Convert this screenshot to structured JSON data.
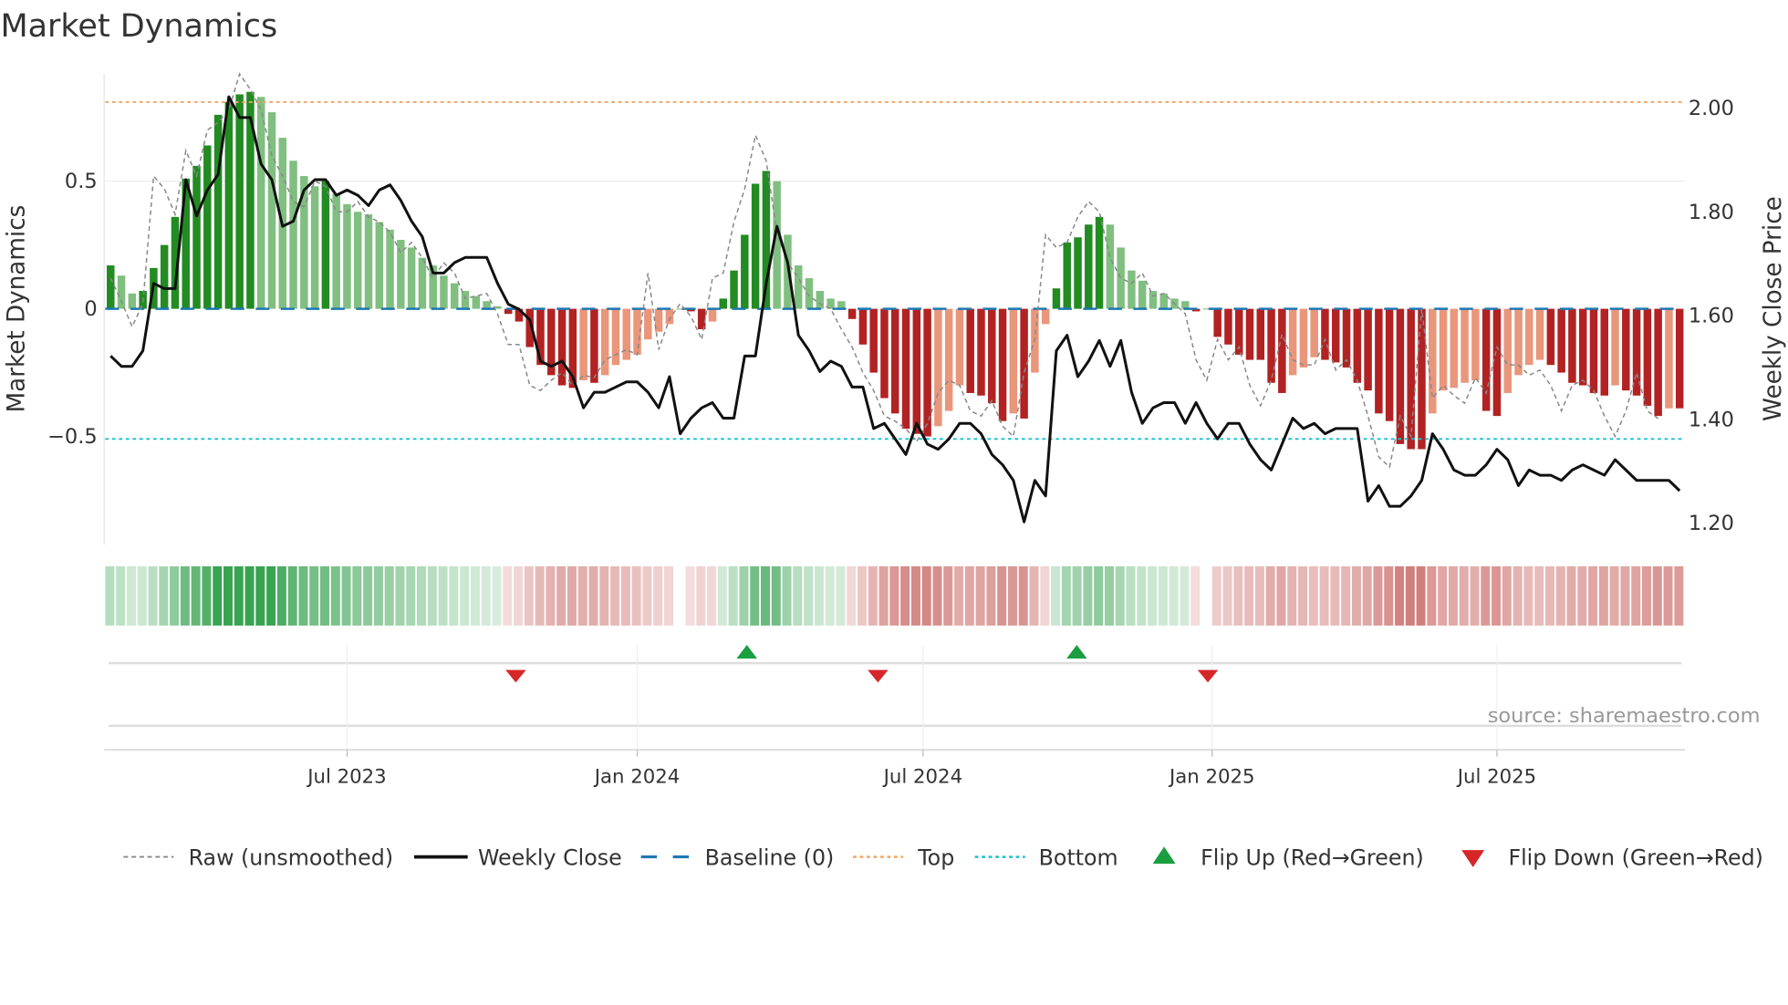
{
  "title": "Market Dynamics",
  "source": "source: sharemaestro.com",
  "colors": {
    "pos_strong": "#228b22",
    "pos_weak": "#80bf80",
    "neg_strong": "#b22222",
    "neg_weak": "#e9967a",
    "heat_pos": "#2e9e48",
    "heat_neg": "#c0504d",
    "baseline": "#1f77b4",
    "top": "#f4a460",
    "bottom": "#17becf",
    "close": "#111111",
    "raw": "#888888",
    "flip_up": "#1a9e3f",
    "flip_down": "#d62728"
  },
  "chart_data": {
    "type": "bar",
    "title": "Market Dynamics",
    "ylabel": "Market Dynamics",
    "y2label": "Weekly Close Price",
    "ylim": [
      -0.92,
      0.92
    ],
    "y2lim": [
      1.18,
      2.04
    ],
    "yticks": [
      {
        "v": 0.5,
        "label": "0.5"
      },
      {
        "v": 0,
        "label": "0"
      },
      {
        "v": -0.5,
        "label": "−0.5"
      }
    ],
    "y2ticks": [
      {
        "v": 2.0,
        "label": "2.00"
      },
      {
        "v": 1.8,
        "label": "1.80"
      },
      {
        "v": 1.6,
        "label": "1.60"
      },
      {
        "v": 1.4,
        "label": "1.40"
      },
      {
        "v": 1.2,
        "label": "1.20"
      }
    ],
    "xticks": [
      {
        "week": 22,
        "label": "Jul 2023"
      },
      {
        "week": 49,
        "label": "Jan 2024"
      },
      {
        "week": 75.6,
        "label": "Jul 2024"
      },
      {
        "week": 102.5,
        "label": "Jan 2025"
      },
      {
        "week": 129,
        "label": "Jul 2025"
      }
    ],
    "top_level": 0.81,
    "bottom_level": -0.51,
    "momentum": [
      0.17,
      0.13,
      0.06,
      0.07,
      0.16,
      0.25,
      0.36,
      0.51,
      0.56,
      0.64,
      0.76,
      0.81,
      0.84,
      0.85,
      0.83,
      0.77,
      0.67,
      0.58,
      0.52,
      0.48,
      0.5,
      0.45,
      0.41,
      0.38,
      0.37,
      0.34,
      0.31,
      0.27,
      0.24,
      0.2,
      0.17,
      0.13,
      0.1,
      0.07,
      0.05,
      0.03,
      0.01,
      -0.02,
      -0.05,
      -0.15,
      -0.22,
      -0.26,
      -0.3,
      -0.31,
      -0.28,
      -0.29,
      -0.26,
      -0.22,
      -0.2,
      -0.18,
      -0.12,
      -0.09,
      -0.06,
      0,
      -0.01,
      -0.08,
      -0.05,
      0.04,
      0.15,
      0.29,
      0.49,
      0.54,
      0.5,
      0.29,
      0.17,
      0.12,
      0.07,
      0.04,
      0.03,
      -0.04,
      -0.14,
      -0.25,
      -0.35,
      -0.41,
      -0.47,
      -0.49,
      -0.5,
      -0.46,
      -0.4,
      -0.3,
      -0.33,
      -0.34,
      -0.37,
      -0.44,
      -0.41,
      -0.43,
      -0.25,
      -0.06,
      0.08,
      0.26,
      0.28,
      0.33,
      0.36,
      0.33,
      0.24,
      0.15,
      0.11,
      0.07,
      0.06,
      0.04,
      0.03,
      -0.01,
      0,
      -0.11,
      -0.14,
      -0.18,
      -0.2,
      -0.2,
      -0.29,
      -0.33,
      -0.26,
      -0.23,
      -0.19,
      -0.2,
      -0.21,
      -0.23,
      -0.29,
      -0.32,
      -0.41,
      -0.44,
      -0.53,
      -0.55,
      -0.55,
      -0.41,
      -0.32,
      -0.31,
      -0.29,
      -0.28,
      -0.4,
      -0.42,
      -0.33,
      -0.26,
      -0.22,
      -0.2,
      -0.22,
      -0.25,
      -0.29,
      -0.3,
      -0.33,
      -0.34,
      -0.3,
      -0.32,
      -0.34,
      -0.38,
      -0.42,
      -0.39,
      -0.39
    ],
    "raw": [
      0.12,
      0.03,
      -0.07,
      0.02,
      0.52,
      0.47,
      0.37,
      0.62,
      0.52,
      0.7,
      0.73,
      0.78,
      0.92,
      0.86,
      0.78,
      0.6,
      0.52,
      0.42,
      0.4,
      0.5,
      0.48,
      0.38,
      0.38,
      0.42,
      0.36,
      0.34,
      0.3,
      0.22,
      0.26,
      0.2,
      0.12,
      0.18,
      0.14,
      0.04,
      0.05,
      0.06,
      -0.02,
      -0.14,
      -0.14,
      -0.3,
      -0.32,
      -0.28,
      -0.25,
      -0.3,
      -0.26,
      -0.27,
      -0.2,
      -0.18,
      -0.16,
      -0.18,
      0.14,
      -0.16,
      -0.04,
      0.02,
      -0.03,
      -0.12,
      0.12,
      0.14,
      0.34,
      0.47,
      0.68,
      0.58,
      0.3,
      0.18,
      0.12,
      0.05,
      0.02,
      0.0,
      -0.08,
      -0.15,
      -0.25,
      -0.32,
      -0.42,
      -0.44,
      -0.47,
      -0.52,
      -0.45,
      -0.33,
      -0.28,
      -0.3,
      -0.4,
      -0.42,
      -0.36,
      -0.46,
      -0.5,
      -0.25,
      -0.12,
      0.29,
      0.24,
      0.26,
      0.36,
      0.42,
      0.38,
      0.2,
      0.12,
      0.1,
      0.14,
      0.05,
      0.06,
      0.02,
      -0.02,
      -0.2,
      -0.28,
      -0.12,
      -0.2,
      -0.15,
      -0.3,
      -0.38,
      -0.28,
      -0.1,
      -0.2,
      -0.22,
      -0.22,
      -0.12,
      -0.24,
      -0.2,
      -0.28,
      -0.42,
      -0.58,
      -0.62,
      -0.42,
      -0.5,
      0.0,
      -0.35,
      -0.3,
      -0.34,
      -0.37,
      -0.27,
      -0.33,
      -0.15,
      -0.22,
      -0.22,
      -0.26,
      -0.24,
      -0.3,
      -0.4,
      -0.3,
      -0.28,
      -0.32,
      -0.42,
      -0.5,
      -0.4,
      -0.25,
      -0.4,
      -0.43
    ],
    "close": [
      1.52,
      1.5,
      1.5,
      1.53,
      1.66,
      1.65,
      1.65,
      1.86,
      1.79,
      1.84,
      1.87,
      2.02,
      1.98,
      1.98,
      1.89,
      1.86,
      1.77,
      1.78,
      1.84,
      1.86,
      1.86,
      1.83,
      1.84,
      1.83,
      1.81,
      1.84,
      1.85,
      1.82,
      1.78,
      1.75,
      1.68,
      1.68,
      1.7,
      1.71,
      1.71,
      1.71,
      1.66,
      1.62,
      1.61,
      1.59,
      1.51,
      1.5,
      1.51,
      1.48,
      1.42,
      1.45,
      1.45,
      1.46,
      1.47,
      1.47,
      1.45,
      1.42,
      1.48,
      1.37,
      1.4,
      1.42,
      1.43,
      1.4,
      1.4,
      1.52,
      1.52,
      1.66,
      1.77,
      1.7,
      1.56,
      1.53,
      1.49,
      1.51,
      1.5,
      1.46,
      1.46,
      1.38,
      1.39,
      1.36,
      1.33,
      1.39,
      1.35,
      1.34,
      1.36,
      1.39,
      1.39,
      1.37,
      1.33,
      1.31,
      1.28,
      1.2,
      1.28,
      1.25,
      1.53,
      1.56,
      1.48,
      1.51,
      1.55,
      1.5,
      1.55,
      1.45,
      1.39,
      1.42,
      1.43,
      1.43,
      1.39,
      1.43,
      1.39,
      1.36,
      1.39,
      1.39,
      1.35,
      1.32,
      1.3,
      1.35,
      1.4,
      1.38,
      1.39,
      1.37,
      1.38,
      1.38,
      1.38,
      1.24,
      1.27,
      1.23,
      1.23,
      1.25,
      1.28,
      1.37,
      1.34,
      1.3,
      1.29,
      1.29,
      1.31,
      1.34,
      1.32,
      1.27,
      1.3,
      1.29,
      1.29,
      1.28,
      1.3,
      1.31,
      1.3,
      1.29,
      1.32,
      1.3,
      1.28,
      1.28,
      1.28,
      1.28,
      1.26
    ],
    "flips": [
      {
        "week": 37.7,
        "dir": "down"
      },
      {
        "week": 59.2,
        "dir": "up"
      },
      {
        "week": 71.4,
        "dir": "down"
      },
      {
        "week": 89.9,
        "dir": "up"
      },
      {
        "week": 102.1,
        "dir": "down"
      }
    ],
    "legend": {
      "placement": "bottom",
      "items": [
        {
          "key": "raw",
          "label": "Raw (unsmoothed)"
        },
        {
          "key": "close",
          "label": "Weekly Close"
        },
        {
          "key": "baseline",
          "label": "Baseline (0)"
        },
        {
          "key": "top",
          "label": "Top"
        },
        {
          "key": "bottom",
          "label": "Bottom"
        },
        {
          "key": "flip_up",
          "label": "Flip Up (Red→Green)"
        },
        {
          "key": "flip_down",
          "label": "Flip Down (Green→Red)"
        }
      ]
    }
  }
}
